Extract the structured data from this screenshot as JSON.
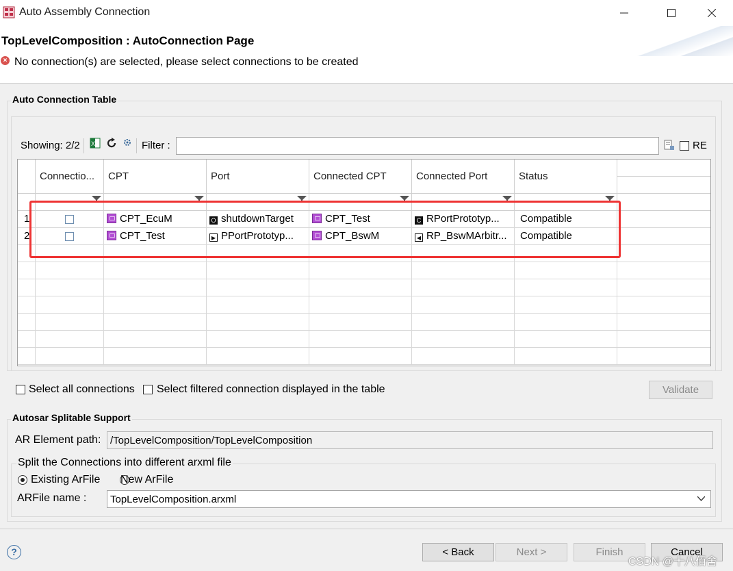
{
  "window": {
    "title": "Auto Assembly Connection"
  },
  "header": {
    "page_title": "TopLevelComposition : AutoConnection Page",
    "error_message": "No connection(s) are selected, please select connections to be created"
  },
  "table_group": {
    "legend": "Auto Connection Table",
    "showing": "Showing: 2/2",
    "filter_label": "Filter :",
    "filter_value": "",
    "re_label": "RE",
    "columns": [
      "Connectio...",
      "CPT",
      "Port",
      "Connected CPT",
      "Connected Port",
      "Status"
    ],
    "rows": [
      {
        "num": "1",
        "cpt": "CPT_EcuM",
        "port": "shutdownTarget",
        "connected_cpt": "CPT_Test",
        "connected_port": "RPortPrototyp...",
        "status": "Compatible"
      },
      {
        "num": "2",
        "cpt": "CPT_Test",
        "port": "PPortPrototyp...",
        "connected_cpt": "CPT_BswM",
        "connected_port": "RP_BswMArbitr...",
        "status": "Compatible"
      }
    ]
  },
  "options": {
    "select_all": "Select all connections",
    "select_filtered": "Select filtered connection displayed in the table",
    "validate": "Validate"
  },
  "split_group": {
    "legend": "Autosar Splitable Support",
    "ar_element_label": "AR Element path:",
    "ar_element_value": "/TopLevelComposition/TopLevelComposition",
    "split_legend": "Split the Connections into different arxml file",
    "existing_label": "Existing ArFile",
    "new_label": "New ArFile",
    "arfile_label": "ARFile name :",
    "arfile_value": "TopLevelComposition.arxml"
  },
  "footer": {
    "back": "< Back",
    "next": "Next >",
    "finish": "Finish",
    "cancel": "Cancel",
    "watermark": "CSDN @十八佰舍"
  },
  "colors": {
    "highlight": "#e33333",
    "error": "#d9534f",
    "component": "#b34fd4"
  }
}
